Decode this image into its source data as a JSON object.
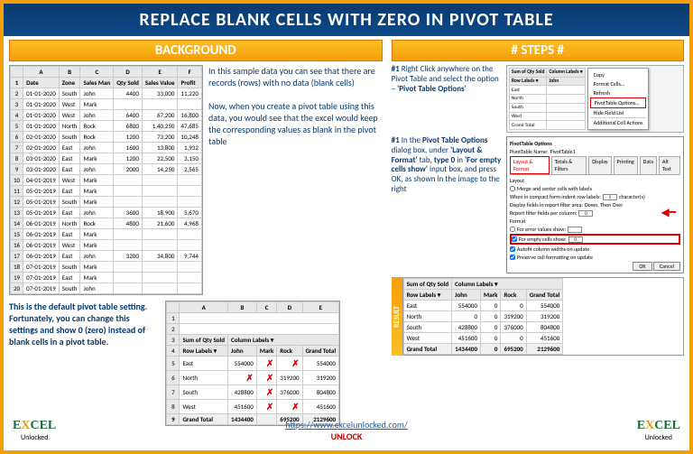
{
  "title": "REPLACE BLANK CELLS WITH ZERO IN PIVOT TABLE",
  "sections": {
    "background": "BACKGROUND",
    "steps": "# STEPS #"
  },
  "source_headers": [
    "",
    "A",
    "B",
    "C",
    "D",
    "E",
    "F"
  ],
  "source_cols": [
    "Date",
    "Zone",
    "Sales Man",
    "Qty Sold",
    "Sales Value",
    "Profit"
  ],
  "source_rows": [
    [
      "2",
      "01-01-2020",
      "South",
      "John",
      "4400",
      "33,000",
      "11,220"
    ],
    [
      "3",
      "01-01-2020",
      "West",
      "Mark",
      "",
      "",
      ""
    ],
    [
      "4",
      "01-01-2020",
      "West",
      "John",
      "6400",
      "67,200",
      "16,800"
    ],
    [
      "5",
      "01-01-2020",
      "North",
      "Rock",
      "6800",
      "1,40,250",
      "47,685"
    ],
    [
      "6",
      "02-01-2020",
      "South",
      "Rock",
      "1200",
      "73,200",
      "10,248"
    ],
    [
      "7",
      "02-01-2020",
      "East",
      "John",
      "1600",
      "13,800",
      "1,932"
    ],
    [
      "8",
      "03-01-2020",
      "East",
      "Mark",
      "1200",
      "22,500",
      "3,150"
    ],
    [
      "9",
      "03-01-2020",
      "East",
      "John",
      "2000",
      "14,250",
      "2,565"
    ],
    [
      "10",
      "04-01-2019",
      "West",
      "Mark",
      "",
      "",
      ""
    ],
    [
      "11",
      "05-01-2019",
      "East",
      "Mark",
      "",
      "",
      ""
    ],
    [
      "12",
      "05-01-2019",
      "South",
      "Mark",
      "",
      "",
      ""
    ],
    [
      "13",
      "05-01-2019",
      "East",
      "John",
      "3600",
      "18,900",
      "5,670"
    ],
    [
      "14",
      "06-01-2019",
      "North",
      "Rock",
      "4800",
      "21,600",
      "4,968"
    ],
    [
      "15",
      "06-01-2019",
      "East",
      "Mark",
      "",
      "",
      ""
    ],
    [
      "16",
      "06-01-2019",
      "West",
      "Mark",
      "",
      "",
      ""
    ],
    [
      "17",
      "06-01-2019",
      "East",
      "John",
      "3200",
      "34,800",
      "9,744"
    ],
    [
      "18",
      "07-01-2019",
      "South",
      "Mark",
      "",
      "",
      ""
    ],
    [
      "19",
      "07-01-2019",
      "East",
      "Mark",
      "",
      "",
      ""
    ],
    [
      "20",
      "07-01-2019",
      "South",
      "John",
      "",
      "",
      ""
    ]
  ],
  "bg_text1": "In this sample data you can see that there are records (rows) with no data (blank cells)",
  "bg_text2": "Now, when you create a pivot table using this data, you would see that the excel would keep the corresponding values as blank in the pivot table",
  "note": "This is the default pivot table setting. Fortunately, you can change this settings and show 0 (zero) instead of blank cells in a pivot table.",
  "pivot1": {
    "corner": "Sum of Qty Sold",
    "col_label": "Column Labels",
    "row_label": "Row Labels",
    "cols": [
      "John",
      "Mark",
      "Rock",
      "Grand Total"
    ],
    "rows": [
      [
        "East",
        "554000",
        "",
        "",
        "554000"
      ],
      [
        "North",
        "",
        "",
        "319200",
        "319200"
      ],
      [
        "South",
        "428800",
        "",
        "376000",
        "804800"
      ],
      [
        "West",
        "451600",
        "",
        "",
        "451600"
      ],
      [
        "Grand Total",
        "1434400",
        "",
        "695200",
        "2129600"
      ]
    ]
  },
  "step1_num": "#1",
  "step1_text": "Right Click anywhere on the Pivot Table and select the option – ",
  "step1_bold": "'Pivot Table Options'",
  "ctx_items": [
    "Copy",
    "Format Cells...",
    "Refresh",
    "PivotTable Options...",
    "Hide Field List",
    "Additional Cell Actions"
  ],
  "step1_mini": {
    "corner": "Sum of Qty Sold",
    "col_label": "Column Labels",
    "row_label": "Row Labels",
    "col": "John",
    "rows": [
      [
        "East",
        ""
      ],
      [
        "North",
        ""
      ],
      [
        "South",
        ""
      ],
      [
        "West",
        ""
      ],
      [
        "Grand Total",
        ""
      ]
    ]
  },
  "step2_num": "#1",
  "step2_text1": "In the ",
  "step2_bold1": "Pivot Table Options",
  "step2_text2": " dialog box, under ",
  "step2_bold2": "'Layout & Format'",
  "step2_text3": " tab, ",
  "step2_bold3": "type 0",
  "step2_text4": " in ",
  "step2_bold4": "'For empty cells show'",
  "step2_text5": " input box, and press OK, as shown in the image to the right",
  "dlg": {
    "title": "PivotTable Options",
    "name_label": "PivotTable Name:",
    "name_val": "PivotTable1",
    "tabs": [
      "Layout & Format",
      "Totals & Filters",
      "Display",
      "Printing",
      "Data",
      "Alt Text"
    ],
    "layout_hdr": "Layout",
    "merge": "Merge and center cells with labels",
    "indent": "When in compact form indent row labels:",
    "indent_val": "1",
    "indent_unit": "character(s)",
    "disp_fields": "Display fields in report filter area:",
    "disp_val": "Down, Then Over",
    "report_filter": "Report filter fields per column:",
    "report_val": "0",
    "format_hdr": "Format",
    "err": "For error values show:",
    "empty": "For empty cells show:",
    "empty_val": "0",
    "autofit": "Autofit column widths on update",
    "preserve": "Preserve cell formatting on update",
    "ok": "OK",
    "cancel": "Cancel"
  },
  "result_label": "RESULT",
  "pivot2": {
    "corner": "Sum of Qty Sold",
    "col_label": "Column Labels",
    "row_label": "Row Labels",
    "cols": [
      "John",
      "Mark",
      "Rock",
      "Grand Total"
    ],
    "rows": [
      [
        "East",
        "554000",
        "0",
        "0",
        "554000"
      ],
      [
        "North",
        "0",
        "0",
        "319200",
        "319200"
      ],
      [
        "South",
        "428800",
        "0",
        "376000",
        "804800"
      ],
      [
        "West",
        "451600",
        "0",
        "0",
        "451600"
      ],
      [
        "Grand Total",
        "1434400",
        "0",
        "695200",
        "2129600"
      ]
    ]
  },
  "logo": {
    "top1": "E",
    "top2": "X",
    "top3": "CEL",
    "bot": "Unlocked"
  },
  "link": "https://www.excelunlocked.com/",
  "unlock": "UNLOCK"
}
